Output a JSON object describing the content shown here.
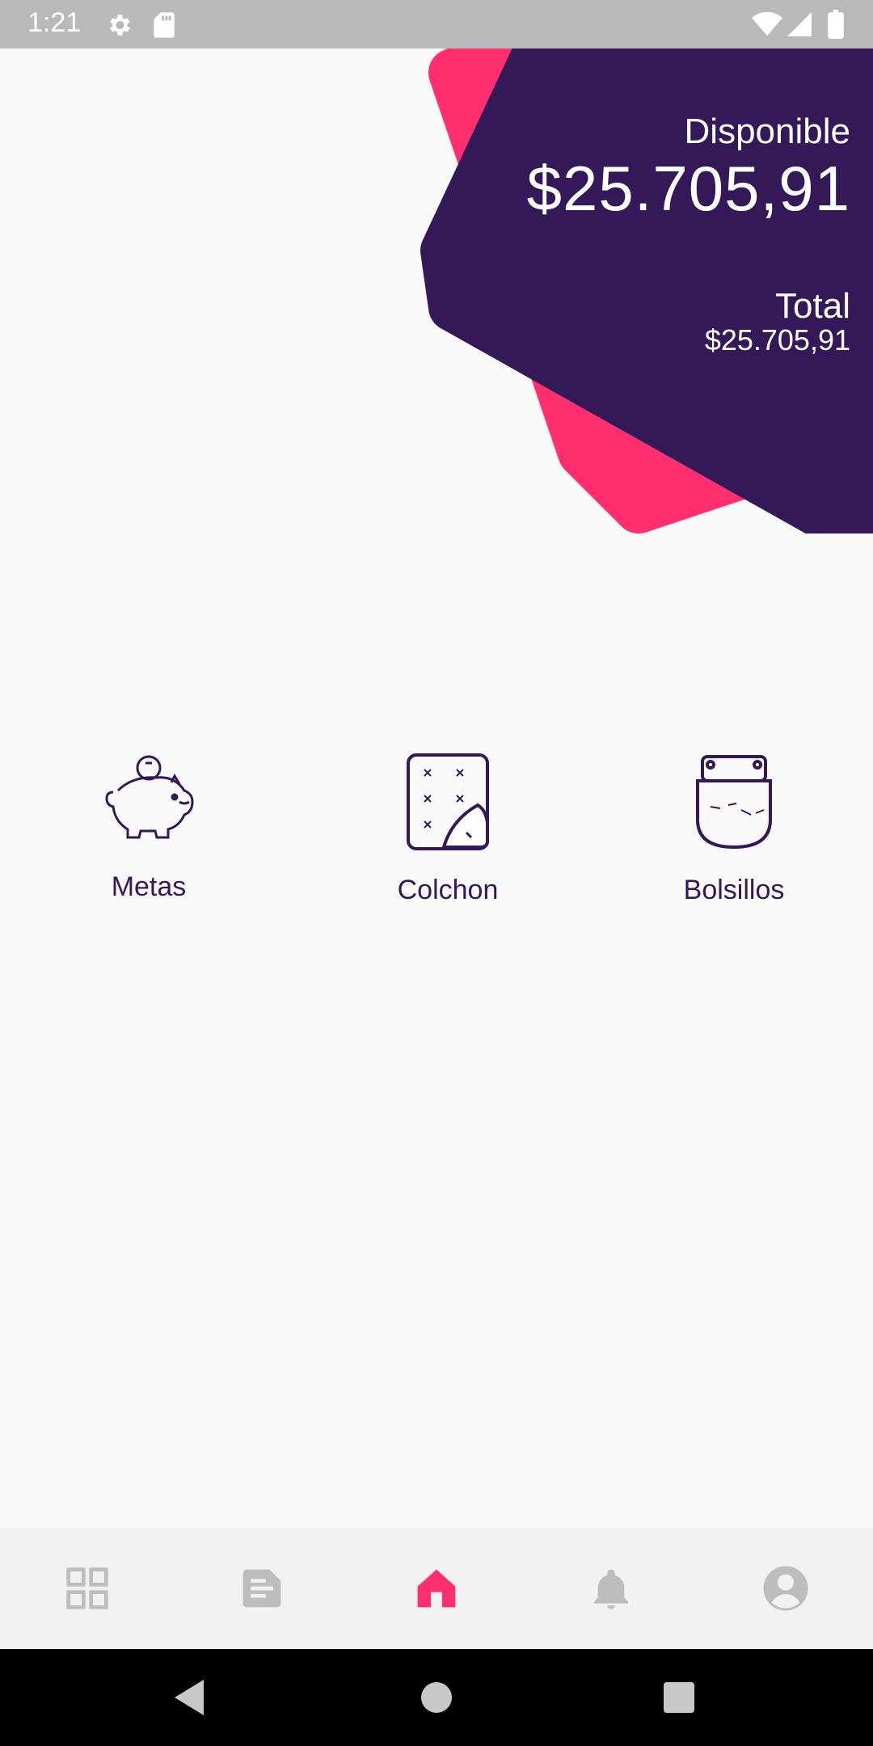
{
  "status_bar": {
    "time": "1:21",
    "icons": [
      "settings-icon",
      "sd-card-icon",
      "wifi-icon",
      "signal-icon",
      "battery-icon"
    ]
  },
  "balance": {
    "available_label": "Disponible",
    "available_amount": "$25.705,91",
    "total_label": "Total",
    "total_amount": "$25.705,91"
  },
  "shortcuts": [
    {
      "label": "Metas",
      "icon": "piggy-bank-icon"
    },
    {
      "label": "Colchon",
      "icon": "mattress-icon"
    },
    {
      "label": "Bolsillos",
      "icon": "pocket-icon"
    }
  ],
  "bottom_nav": [
    {
      "icon": "grid-icon",
      "active": false
    },
    {
      "icon": "document-icon",
      "active": false
    },
    {
      "icon": "home-icon",
      "active": true
    },
    {
      "icon": "bell-icon",
      "active": false
    },
    {
      "icon": "profile-icon",
      "active": false
    }
  ],
  "colors": {
    "primary": "#351858",
    "accent": "#ff2e6f",
    "nav_inactive": "#bdbdbd",
    "background": "#f9f9f9"
  }
}
